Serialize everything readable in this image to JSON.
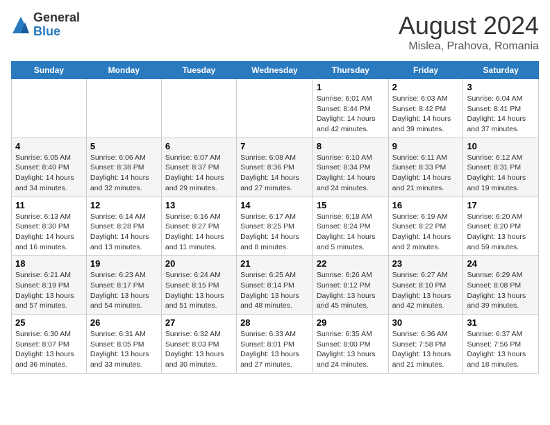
{
  "logo": {
    "general": "General",
    "blue": "Blue"
  },
  "title": "August 2024",
  "location": "Mislea, Prahova, Romania",
  "days_of_week": [
    "Sunday",
    "Monday",
    "Tuesday",
    "Wednesday",
    "Thursday",
    "Friday",
    "Saturday"
  ],
  "weeks": [
    [
      {
        "day": "",
        "info": ""
      },
      {
        "day": "",
        "info": ""
      },
      {
        "day": "",
        "info": ""
      },
      {
        "day": "",
        "info": ""
      },
      {
        "day": "1",
        "info": "Sunrise: 6:01 AM\nSunset: 8:44 PM\nDaylight: 14 hours and 42 minutes."
      },
      {
        "day": "2",
        "info": "Sunrise: 6:03 AM\nSunset: 8:42 PM\nDaylight: 14 hours and 39 minutes."
      },
      {
        "day": "3",
        "info": "Sunrise: 6:04 AM\nSunset: 8:41 PM\nDaylight: 14 hours and 37 minutes."
      }
    ],
    [
      {
        "day": "4",
        "info": "Sunrise: 6:05 AM\nSunset: 8:40 PM\nDaylight: 14 hours and 34 minutes."
      },
      {
        "day": "5",
        "info": "Sunrise: 6:06 AM\nSunset: 8:38 PM\nDaylight: 14 hours and 32 minutes."
      },
      {
        "day": "6",
        "info": "Sunrise: 6:07 AM\nSunset: 8:37 PM\nDaylight: 14 hours and 29 minutes."
      },
      {
        "day": "7",
        "info": "Sunrise: 6:08 AM\nSunset: 8:36 PM\nDaylight: 14 hours and 27 minutes."
      },
      {
        "day": "8",
        "info": "Sunrise: 6:10 AM\nSunset: 8:34 PM\nDaylight: 14 hours and 24 minutes."
      },
      {
        "day": "9",
        "info": "Sunrise: 6:11 AM\nSunset: 8:33 PM\nDaylight: 14 hours and 21 minutes."
      },
      {
        "day": "10",
        "info": "Sunrise: 6:12 AM\nSunset: 8:31 PM\nDaylight: 14 hours and 19 minutes."
      }
    ],
    [
      {
        "day": "11",
        "info": "Sunrise: 6:13 AM\nSunset: 8:30 PM\nDaylight: 14 hours and 16 minutes."
      },
      {
        "day": "12",
        "info": "Sunrise: 6:14 AM\nSunset: 8:28 PM\nDaylight: 14 hours and 13 minutes."
      },
      {
        "day": "13",
        "info": "Sunrise: 6:16 AM\nSunset: 8:27 PM\nDaylight: 14 hours and 11 minutes."
      },
      {
        "day": "14",
        "info": "Sunrise: 6:17 AM\nSunset: 8:25 PM\nDaylight: 14 hours and 8 minutes."
      },
      {
        "day": "15",
        "info": "Sunrise: 6:18 AM\nSunset: 8:24 PM\nDaylight: 14 hours and 5 minutes."
      },
      {
        "day": "16",
        "info": "Sunrise: 6:19 AM\nSunset: 8:22 PM\nDaylight: 14 hours and 2 minutes."
      },
      {
        "day": "17",
        "info": "Sunrise: 6:20 AM\nSunset: 8:20 PM\nDaylight: 13 hours and 59 minutes."
      }
    ],
    [
      {
        "day": "18",
        "info": "Sunrise: 6:21 AM\nSunset: 8:19 PM\nDaylight: 13 hours and 57 minutes."
      },
      {
        "day": "19",
        "info": "Sunrise: 6:23 AM\nSunset: 8:17 PM\nDaylight: 13 hours and 54 minutes."
      },
      {
        "day": "20",
        "info": "Sunrise: 6:24 AM\nSunset: 8:15 PM\nDaylight: 13 hours and 51 minutes."
      },
      {
        "day": "21",
        "info": "Sunrise: 6:25 AM\nSunset: 8:14 PM\nDaylight: 13 hours and 48 minutes."
      },
      {
        "day": "22",
        "info": "Sunrise: 6:26 AM\nSunset: 8:12 PM\nDaylight: 13 hours and 45 minutes."
      },
      {
        "day": "23",
        "info": "Sunrise: 6:27 AM\nSunset: 8:10 PM\nDaylight: 13 hours and 42 minutes."
      },
      {
        "day": "24",
        "info": "Sunrise: 6:29 AM\nSunset: 8:08 PM\nDaylight: 13 hours and 39 minutes."
      }
    ],
    [
      {
        "day": "25",
        "info": "Sunrise: 6:30 AM\nSunset: 8:07 PM\nDaylight: 13 hours and 36 minutes."
      },
      {
        "day": "26",
        "info": "Sunrise: 6:31 AM\nSunset: 8:05 PM\nDaylight: 13 hours and 33 minutes."
      },
      {
        "day": "27",
        "info": "Sunrise: 6:32 AM\nSunset: 8:03 PM\nDaylight: 13 hours and 30 minutes."
      },
      {
        "day": "28",
        "info": "Sunrise: 6:33 AM\nSunset: 8:01 PM\nDaylight: 13 hours and 27 minutes."
      },
      {
        "day": "29",
        "info": "Sunrise: 6:35 AM\nSunset: 8:00 PM\nDaylight: 13 hours and 24 minutes."
      },
      {
        "day": "30",
        "info": "Sunrise: 6:36 AM\nSunset: 7:58 PM\nDaylight: 13 hours and 21 minutes."
      },
      {
        "day": "31",
        "info": "Sunrise: 6:37 AM\nSunset: 7:56 PM\nDaylight: 13 hours and 18 minutes."
      }
    ]
  ]
}
